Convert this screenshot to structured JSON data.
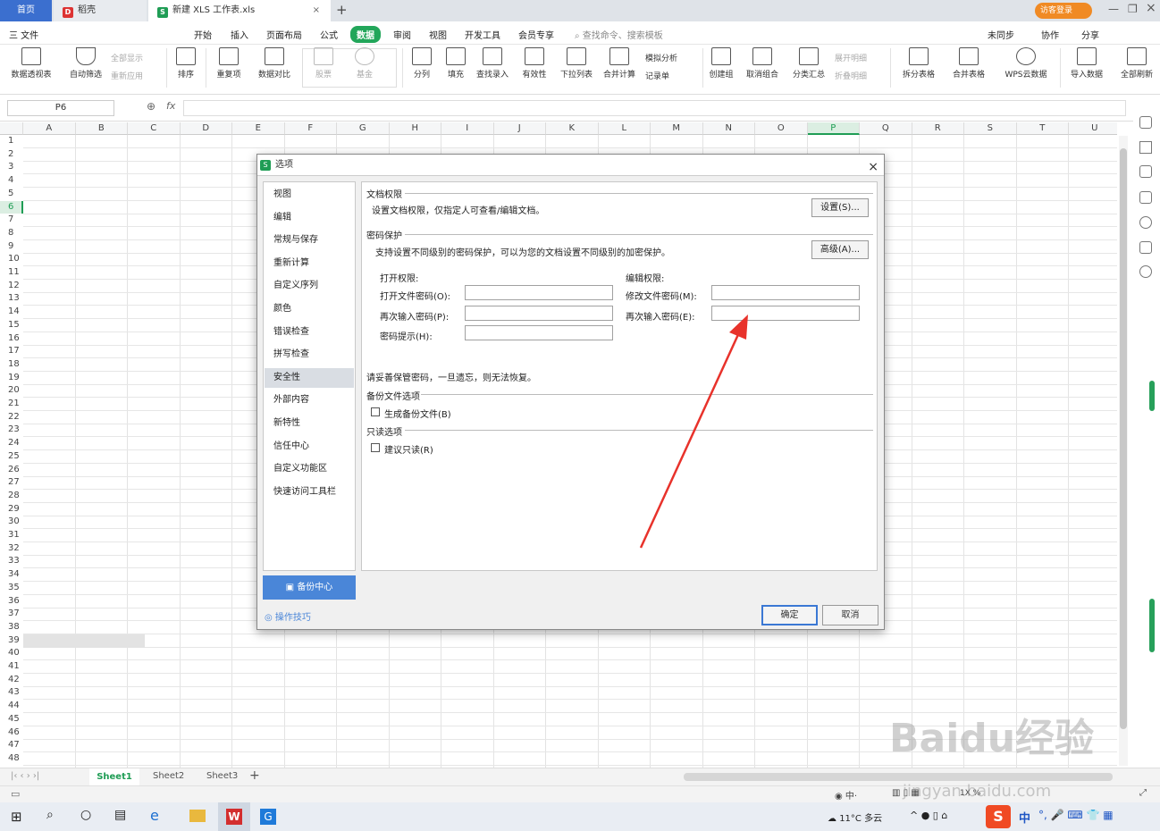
{
  "tabs": {
    "home": "首页",
    "docer": "稻壳",
    "file": "新建 XLS 工作表.xls",
    "login": "访客登录"
  },
  "menu": {
    "file": "三 文件",
    "items": [
      "开始",
      "插入",
      "页面布局",
      "公式",
      "数据",
      "审阅",
      "视图",
      "开发工具",
      "会员专享"
    ],
    "search": "查找命令、搜索模板",
    "sync": "未同步",
    "collab": "协作",
    "share": "分享"
  },
  "ribbon": {
    "buttons": [
      "数据透视表",
      "自动筛选",
      "排序",
      "重复项",
      "数据对比",
      "股票",
      "基金",
      "分列",
      "填充",
      "查找录入",
      "有效性",
      "下拉列表",
      "合并计算",
      "记录单",
      "创建组",
      "取消组合",
      "分类汇总",
      "拆分表格",
      "合并表格",
      "WPS云数据",
      "导入数据",
      "全部刷新"
    ],
    "show_all": "全部显示",
    "reapply": "重新应用",
    "simulate": "模拟分析",
    "expand": "展开明细",
    "collapse": "折叠明细"
  },
  "formula": {
    "cell_ref": "P6",
    "fx": "fx"
  },
  "columns": [
    "A",
    "B",
    "C",
    "D",
    "E",
    "F",
    "G",
    "H",
    "I",
    "J",
    "K",
    "L",
    "M",
    "N",
    "O",
    "P",
    "Q",
    "R",
    "S",
    "T",
    "U"
  ],
  "sheets": [
    "Sheet1",
    "Sheet2",
    "Sheet3"
  ],
  "status": {
    "zoom": "1X %"
  },
  "dialog": {
    "title": "选项",
    "nav": [
      "视图",
      "编辑",
      "常规与保存",
      "重新计算",
      "自定义序列",
      "颜色",
      "错误检查",
      "拼写检查",
      "安全性",
      "外部内容",
      "新特性",
      "信任中心",
      "自定义功能区",
      "快速访问工具栏"
    ],
    "backup_center": "备份中心",
    "tips": "操作技巧",
    "doc_perm": {
      "title": "文档权限",
      "desc": "设置文档权限，仅指定人可查看/编辑文档。",
      "button": "设置(S)..."
    },
    "pwd": {
      "title": "密码保护",
      "desc": "支持设置不同级别的密码保护，可以为您的文档设置不同级别的加密保护。",
      "button": "高级(A)...",
      "open_title": "打开权限:",
      "open_pwd": "打开文件密码(O):",
      "open_re": "再次输入密码(P):",
      "hint": "密码提示(H):",
      "edit_title": "编辑权限:",
      "edit_pwd": "修改文件密码(M):",
      "edit_re": "再次输入密码(E):"
    },
    "warning": "请妥善保管密码，一旦遗忘，则无法恢复。",
    "backup": {
      "title": "备份文件选项",
      "cb": "生成备份文件(B)"
    },
    "readonly": {
      "title": "只读选项",
      "cb": "建议只读(R)"
    },
    "ok": "确定",
    "cancel": "取消"
  },
  "taskbar": {
    "weather": "11°C 多云",
    "ime": "中"
  },
  "watermark": {
    "brand": "Baidu经验",
    "url": "jingyan.baidu.com"
  }
}
